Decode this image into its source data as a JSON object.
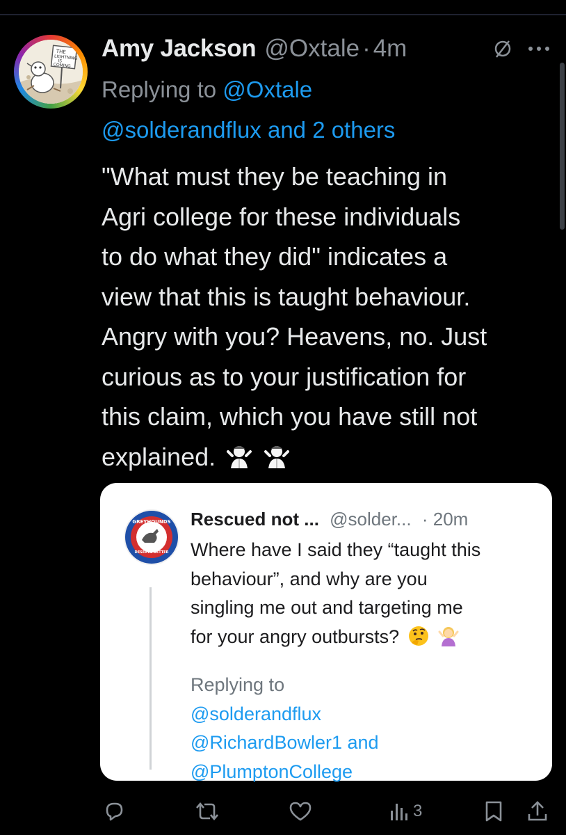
{
  "tweet": {
    "author_name": "Amy Jackson",
    "author_handle": "@Oxtale",
    "separator": "·",
    "time": "4m",
    "replying_prefix": "Replying to",
    "replying_to_1": "@Oxtale",
    "replying_to_2": "@solderandflux and 2 others",
    "text_lines": [
      "\"What must they be teaching in",
      "Agri college for these individuals",
      "to do what they did\" indicates a",
      "view that this is taught behaviour.",
      "Angry with you? Heavens, no. Just",
      "curious as to your justification for",
      "this claim, which you have still not",
      "explained."
    ],
    "avatar_sign_text": "The Lightning is Coming",
    "icons": [
      "muted-circle-icon",
      "more-icon",
      "shrug-emoji",
      "shrug-emoji"
    ]
  },
  "quoted_screenshot": {
    "author_name": "Rescued not ...",
    "author_handle": "@solder...",
    "separator": "·",
    "time": "20m",
    "text_lines": [
      "Where have I said they “taught this",
      "behaviour”, and why are you",
      "singling me out and targeting me",
      "for your angry outbursts?"
    ],
    "replying_prefix": "Replying to",
    "replying_to_lines": [
      "@solderandflux",
      "@RichardBowler1 and",
      "@PlumptonCollege"
    ],
    "avatar_text_top": "GREYHOUNDS",
    "avatar_text_bottom": "DESERVE BETTER",
    "icons": [
      "thinking-emoji",
      "shrug-woman-emoji"
    ]
  },
  "actions": {
    "reply_count": "",
    "retweet_count": "",
    "like_count": "",
    "views_count": "3",
    "icons": [
      "reply-icon",
      "retweet-icon",
      "like-icon",
      "views-icon",
      "bookmark-icon",
      "share-icon"
    ]
  },
  "colors": {
    "background": "#000000",
    "text": "#e7e9ea",
    "muted": "#8b9198",
    "link": "#1d9bf0"
  }
}
